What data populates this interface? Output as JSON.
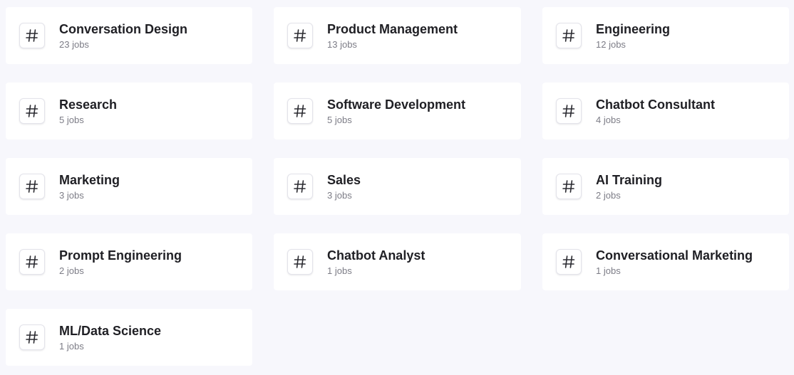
{
  "categories": [
    {
      "name": "Conversation Design",
      "count": "23 jobs"
    },
    {
      "name": "Product Management",
      "count": "13 jobs"
    },
    {
      "name": "Engineering",
      "count": "12 jobs"
    },
    {
      "name": "Research",
      "count": "5 jobs"
    },
    {
      "name": "Software Development",
      "count": "5 jobs"
    },
    {
      "name": "Chatbot Consultant",
      "count": "4 jobs"
    },
    {
      "name": "Marketing",
      "count": "3 jobs"
    },
    {
      "name": "Sales",
      "count": "3 jobs"
    },
    {
      "name": "AI Training",
      "count": "2 jobs"
    },
    {
      "name": "Prompt Engineering",
      "count": "2 jobs"
    },
    {
      "name": "Chatbot Analyst",
      "count": "1 jobs"
    },
    {
      "name": "Conversational Marketing",
      "count": "1 jobs"
    },
    {
      "name": "ML/Data Science",
      "count": "1 jobs"
    }
  ],
  "icon": "hash-icon",
  "colors": {
    "background": "#f7f7fc",
    "card": "#ffffff",
    "title": "#1f1f24",
    "count": "#7c7c86"
  }
}
